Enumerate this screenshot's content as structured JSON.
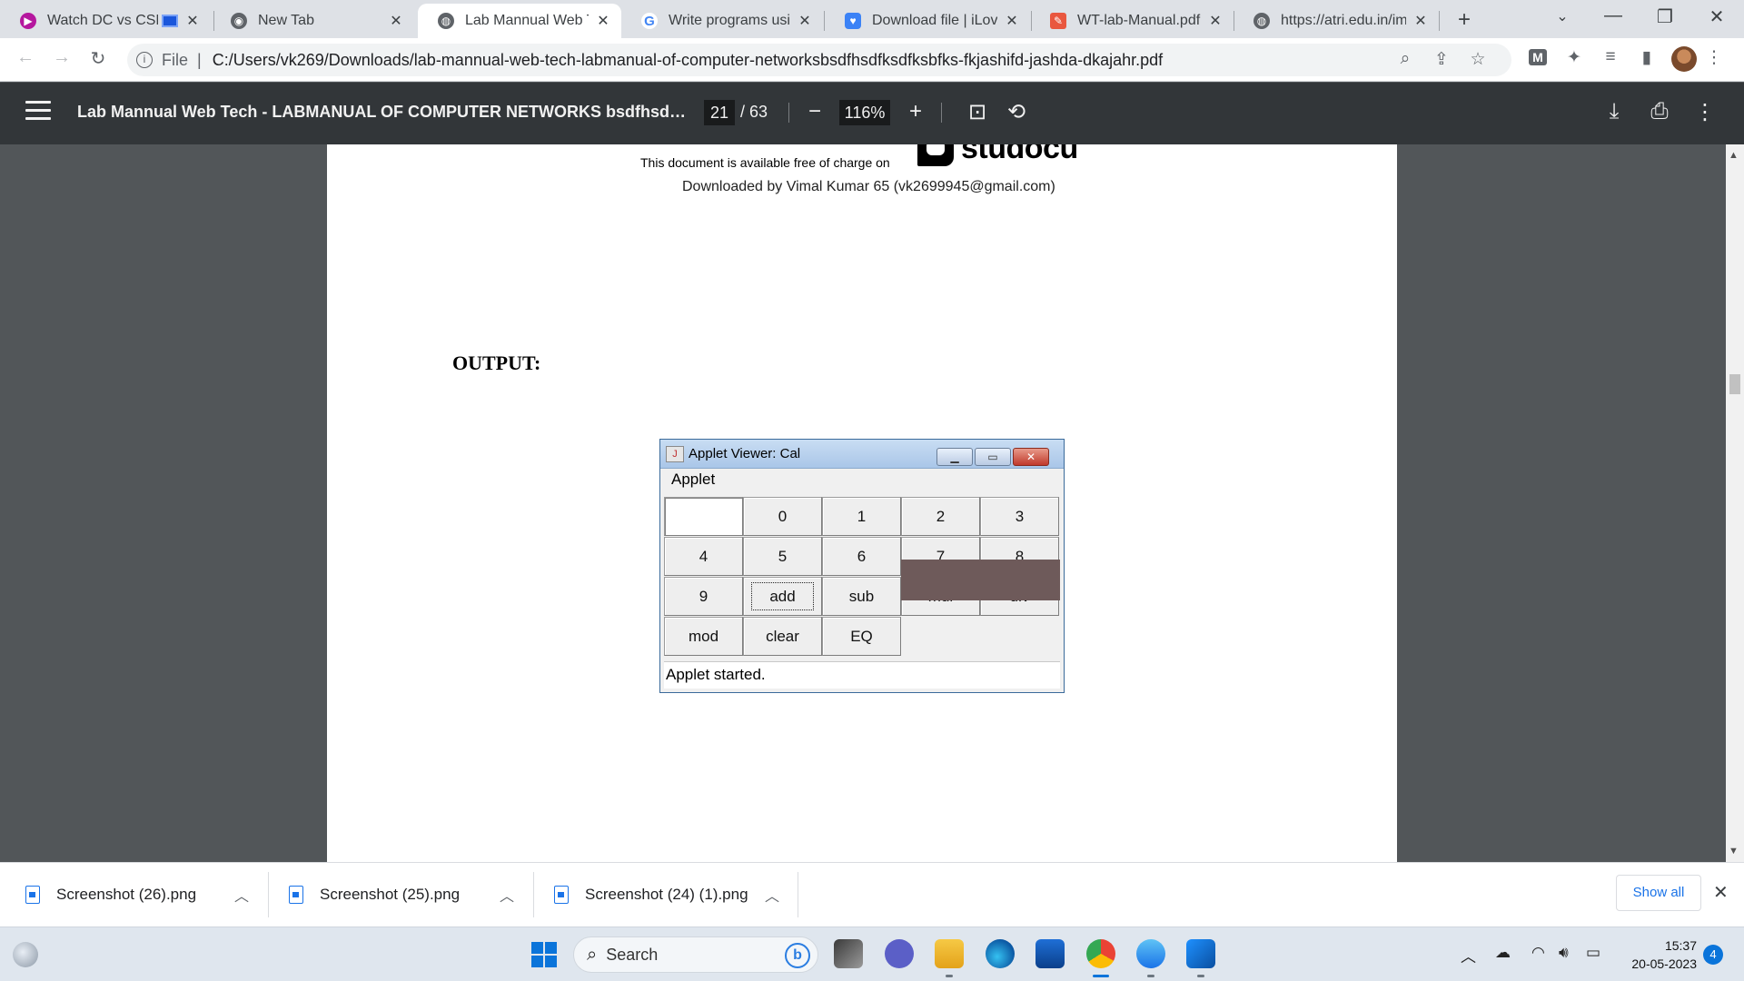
{
  "browser": {
    "tabs": [
      {
        "title": "Watch DC vs CSK",
        "favicon": "sports-icon",
        "color": "#b5179e"
      },
      {
        "title": "New Tab",
        "favicon": "chrome-icon",
        "color": "#5f6368"
      },
      {
        "title": "Lab Mannual Web Tec",
        "favicon": "globe-icon",
        "color": "#5f6368",
        "active": true
      },
      {
        "title": "Write programs using",
        "favicon": "google-icon",
        "color": "#4285f4"
      },
      {
        "title": "Download file | iLovel",
        "favicon": "ilovepdf-icon",
        "color": "#3b82f6"
      },
      {
        "title": "WT-lab-Manual.pdf",
        "favicon": "pdf-icon",
        "color": "#e9573f"
      },
      {
        "title": "https://atri.edu.in/ima",
        "favicon": "globe-icon",
        "color": "#5f6368"
      }
    ],
    "new_tab_label": "+",
    "url_scheme": "File",
    "url": "C:/Users/vk269/Downloads/lab-mannual-web-tech-labmanual-of-computer-networksbsdfhsdfksdfksbfks-fkjashifd-jashda-dkajahr.pdf",
    "extension_badge": "M"
  },
  "pdf_viewer": {
    "title": "Lab Mannual Web Tech - LABMANUAL OF COMPUTER NETWORKS bsdfhsdfksdfksb...",
    "current_page": "21",
    "total_pages": "/ 63",
    "zoom": "116%",
    "zoom_out": "−",
    "zoom_in": "+"
  },
  "document": {
    "studocu_notice": "This document is available free of charge on",
    "studocu_brand": "studocu",
    "downloaded_by": "Downloaded by Vimal Kumar 65 (vk2699945@gmail.com)",
    "heading": "OUTPUT:"
  },
  "applet": {
    "window_title": "Applet Viewer: Cal",
    "java_icon": "J",
    "menu": "Applet",
    "field_value": "",
    "buttons": [
      "0",
      "1",
      "2",
      "3",
      "4",
      "5",
      "6",
      "7",
      "8",
      "9",
      "add",
      "sub",
      "mul",
      "div",
      "mod",
      "clear",
      "EQ"
    ],
    "focused_button": "add",
    "status": "Applet started.",
    "filler_color": "#6e5a5a"
  },
  "downloads": {
    "items": [
      "Screenshot (26).png",
      "Screenshot (25).png",
      "Screenshot (24) (1).png"
    ],
    "show_all": "Show all"
  },
  "taskbar": {
    "search_placeholder": "Search",
    "bing_label": "b",
    "time": "15:37",
    "date": "20-05-2023",
    "notifications": "4"
  }
}
